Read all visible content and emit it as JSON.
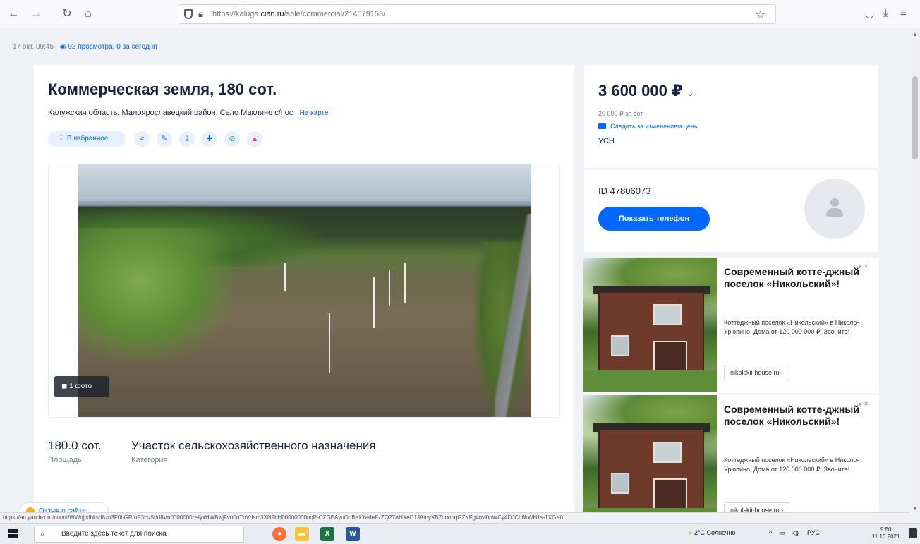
{
  "browser": {
    "url_prefix": "https://kaluga.",
    "url_domain": "cian.ru",
    "url_path": "/sale/commercial/214579153/"
  },
  "meta": {
    "date": "17 окт, 09:45",
    "views": "92 просмотра, 0 за сегодня"
  },
  "listing": {
    "title": "Коммерческая земля, 180 сот.",
    "address": "Калужская область, Малоярославецкий район, Село Маклино с/пос",
    "map_link": "На карте",
    "favorite_label": "В избранное",
    "photo_count": "1 фото",
    "facts": [
      {
        "value": "180.0 сот.",
        "label": "Площадь"
      },
      {
        "value": "Участок сельскохозяйственного назначения",
        "label": "Категория"
      }
    ]
  },
  "price": {
    "amount": "3 600 000 ₽",
    "per_unit": "20 000 ₽ за сот.",
    "follow": "Следить за изменением цены",
    "tax": "УСН"
  },
  "contact": {
    "id": "ID 47806073",
    "phone_button": "Показать телефон"
  },
  "ads": [
    {
      "title": "Современный котте-джный поселок «Никольский»!",
      "text": "Коттеджный поселок «Никольский» в Николо-Урюпино. Дома от 120 000 000 ₽. Звоните!",
      "link": "nikolskii-house.ru ›"
    },
    {
      "title": "Современный котте-джный поселок «Никольский»!",
      "text": "Коттеджный поселок «Никольский» в Николо-Урюпино. Дома от 120 000 000 ₽. Звоните!",
      "link": "nikolskii-house.ru ›"
    }
  ],
  "feedback": "Отзыв о сайте",
  "status_url": "https://an.yandex.ru/count/WWqjjsfhksd8zu3F0bGRmP3Hz5dd8Vn0000000bsiyxHWBwjFvu0nTnVdsm3XN9bH00000000uqP-CZGEAyuOdBKkYadeFzZQ2TAHXeD1JAtnyXB7nrxmqGZKFg4ovi0pWCy4DJCh6kWH1s-1XGK0",
  "taskbar": {
    "search_placeholder": "Введите здесь текст для поиска",
    "weather": "2°C Солнечно",
    "lang": "РУС",
    "time": "9:50",
    "date": "11.10.2021"
  }
}
